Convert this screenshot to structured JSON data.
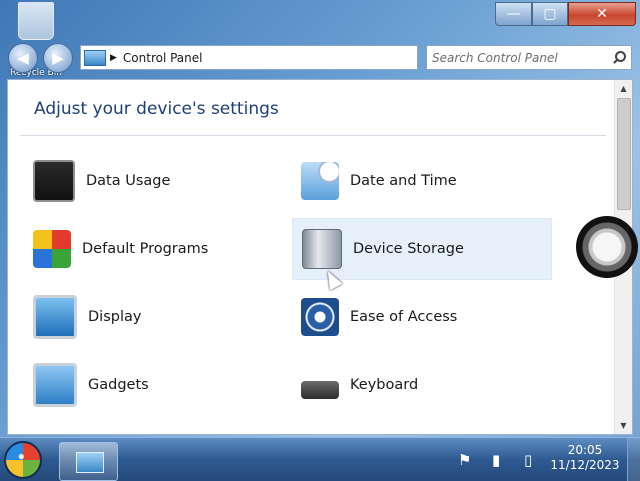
{
  "desktop": {
    "recycle_label": "Recycle Bin"
  },
  "window": {
    "controls": {
      "minimize": "—",
      "maximize": "▢",
      "close": "✕"
    },
    "nav": {
      "back": "◀",
      "forward": "▶"
    },
    "address": {
      "chevron": "▶",
      "location": "Control Panel"
    },
    "search": {
      "placeholder": "Search Control Panel"
    }
  },
  "content": {
    "title": "Adjust your device's settings",
    "items": [
      {
        "label": "Data Usage",
        "icon": "data-usage-icon"
      },
      {
        "label": "Date and Time",
        "icon": "date-time-icon"
      },
      {
        "label": "Default Programs",
        "icon": "default-programs-icon"
      },
      {
        "label": "Device Storage",
        "icon": "device-storage-icon",
        "highlighted": true
      },
      {
        "label": "Display",
        "icon": "display-icon"
      },
      {
        "label": "Ease of Access",
        "icon": "ease-of-access-icon"
      },
      {
        "label": "Gadgets",
        "icon": "gadgets-icon"
      },
      {
        "label": "Keyboard",
        "icon": "keyboard-icon"
      }
    ],
    "scroll": {
      "up": "▲",
      "down": "▼"
    }
  },
  "taskbar": {
    "tray": {
      "flag": "⚑",
      "signal": "▮",
      "battery": "▯"
    },
    "clock": {
      "time": "20:05",
      "date": "11/12/2023"
    }
  },
  "colors": {
    "title_blue": "#1e3f73",
    "highlight": "#e6f0fb",
    "taskbar": "#2e5a92"
  }
}
